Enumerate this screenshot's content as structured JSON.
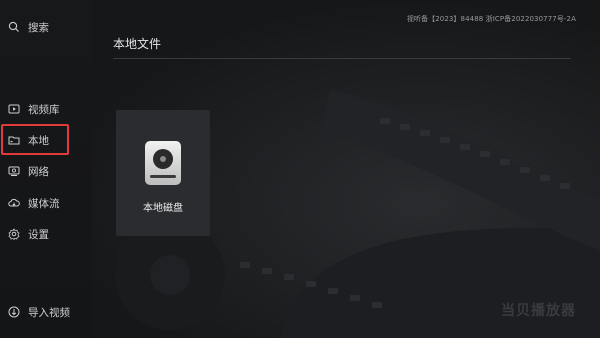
{
  "sidebar": {
    "search_label": "搜索",
    "items": [
      {
        "label": "视频库",
        "icon": "video-library-icon"
      },
      {
        "label": "本地",
        "icon": "folder-icon"
      },
      {
        "label": "网络",
        "icon": "network-icon"
      },
      {
        "label": "媒体流",
        "icon": "cloud-icon"
      },
      {
        "label": "设置",
        "icon": "gear-icon"
      }
    ],
    "import_label": "导入视频",
    "selected_index": 1,
    "highlight_color": "#e23b3b"
  },
  "header": {
    "icp_text": "视听备【2023】84488  浙ICP备2022030777号-2A",
    "title": "本地文件"
  },
  "content": {
    "tiles": [
      {
        "label": "本地磁盘",
        "icon": "hard-disk-icon"
      }
    ]
  },
  "brand": {
    "watermark": "当贝播放器"
  }
}
